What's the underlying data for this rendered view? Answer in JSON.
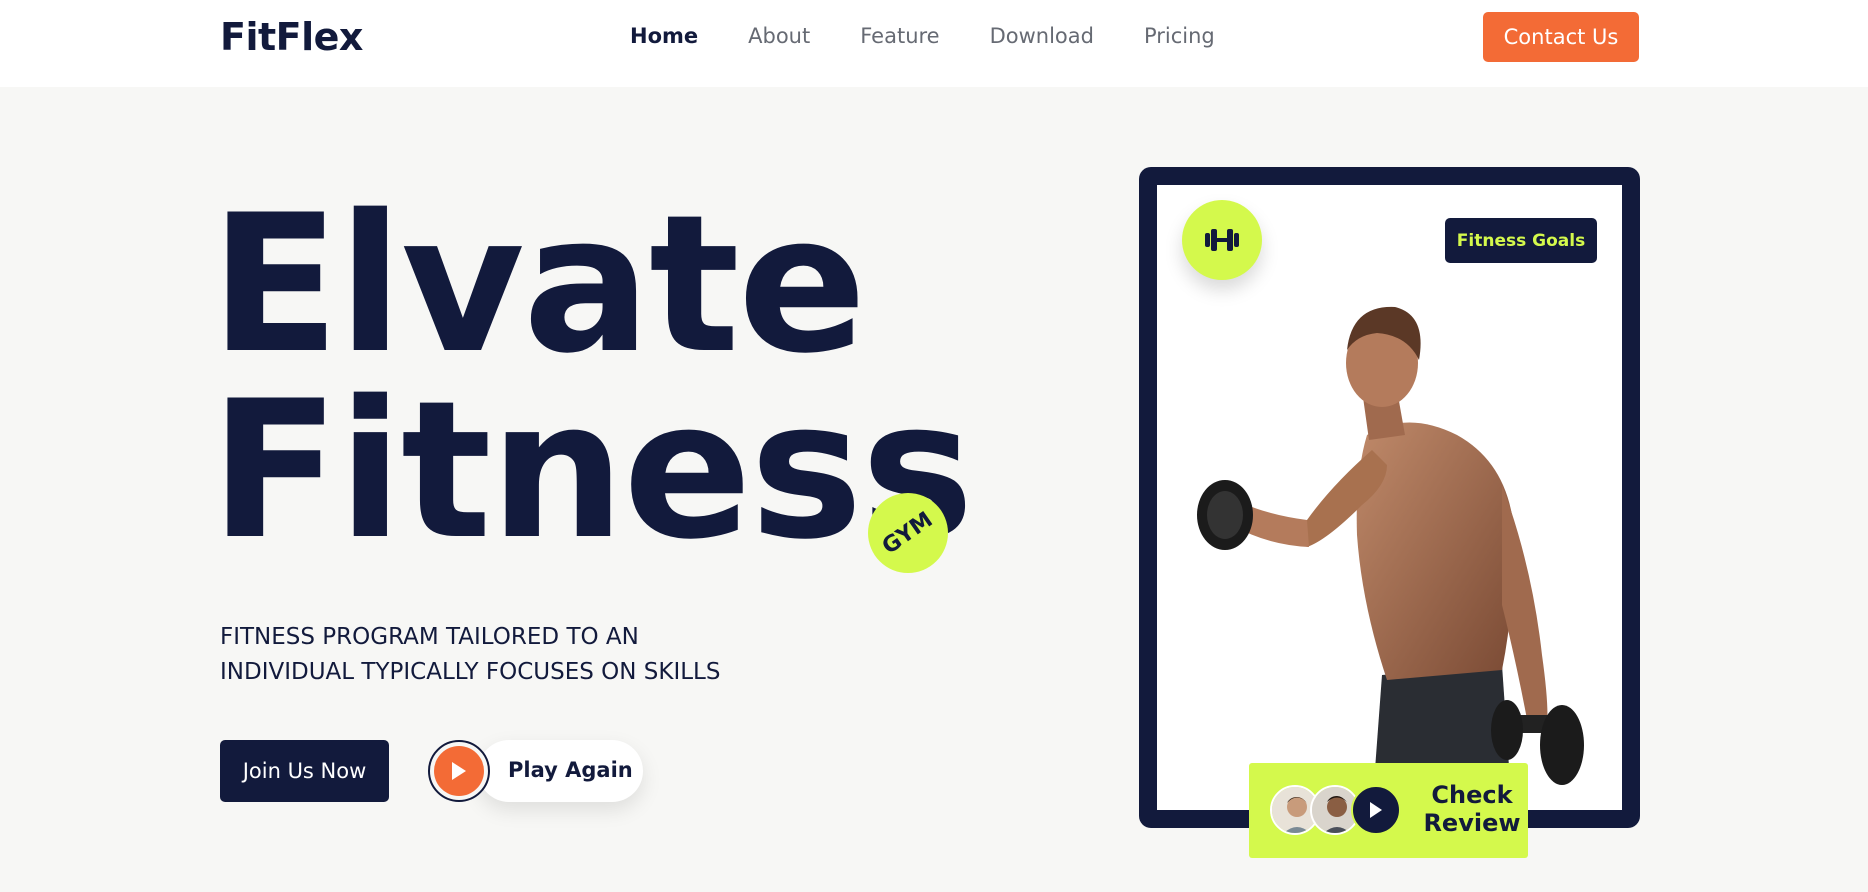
{
  "brand": {
    "name": "FitFlex"
  },
  "nav": {
    "items": [
      {
        "label": "Home",
        "active": true
      },
      {
        "label": "About",
        "active": false
      },
      {
        "label": "Feature",
        "active": false
      },
      {
        "label": "Download",
        "active": false
      },
      {
        "label": "Pricing",
        "active": false
      }
    ],
    "contact_label": "Contact Us"
  },
  "hero": {
    "headline_line1": "Elvate",
    "headline_line2": "Fitness",
    "badge": "GYM",
    "tagline_line1": "FITNESS PROGRAM TAILORED TO AN",
    "tagline_line2": "INDIVIDUAL TYPICALLY FOCUSES ON SKILLS",
    "join_label": "Join Us Now",
    "play_label": "Play Again"
  },
  "card": {
    "goals_tag": "Fitness Goals",
    "review_line1": "Check",
    "review_line2": "Review",
    "dumbbell_icon": "dumbbell-icon"
  },
  "colors": {
    "navy": "#121a3c",
    "accent_orange": "#f36b36",
    "accent_lime": "#d4f94c",
    "background": "#f7f7f5"
  }
}
